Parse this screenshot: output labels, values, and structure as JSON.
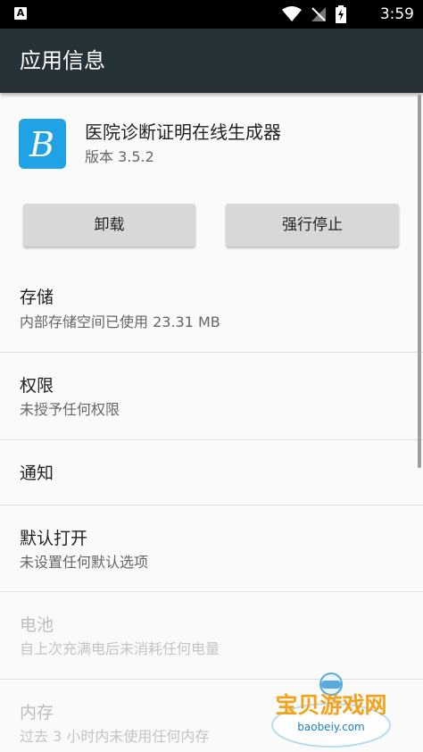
{
  "status_bar": {
    "notification_letter": "A",
    "time": "3:59",
    "icons": [
      "wifi-icon",
      "no-signal-icon",
      "battery-charging-icon"
    ]
  },
  "app_bar": {
    "title": "应用信息"
  },
  "app": {
    "name": "医院诊断证明在线生成器",
    "version": "版本 3.5.2",
    "icon_letter": "B",
    "icon_color": "#1fa3e6"
  },
  "buttons": {
    "uninstall": "卸载",
    "force_stop": "强行停止"
  },
  "items": [
    {
      "title": "存储",
      "summary": "内部存储空间已使用 23.31 MB",
      "enabled": true
    },
    {
      "title": "权限",
      "summary": "未授予任何权限",
      "enabled": true
    },
    {
      "title": "通知",
      "summary": "",
      "enabled": true
    },
    {
      "title": "默认打开",
      "summary": "未设置任何默认选项",
      "enabled": true
    },
    {
      "title": "电池",
      "summary": "自上次充满电后未消耗任何电量",
      "enabled": false
    },
    {
      "title": "内存",
      "summary": "过去 3 小时内未使用任何内存",
      "enabled": false
    }
  ],
  "watermark": {
    "text": "宝贝游戏网",
    "domain": "baobeiy.com"
  },
  "colors": {
    "app_bar": "#263238",
    "status_bar": "#000000",
    "background": "#fafafa",
    "button": "#d8d8d8"
  }
}
